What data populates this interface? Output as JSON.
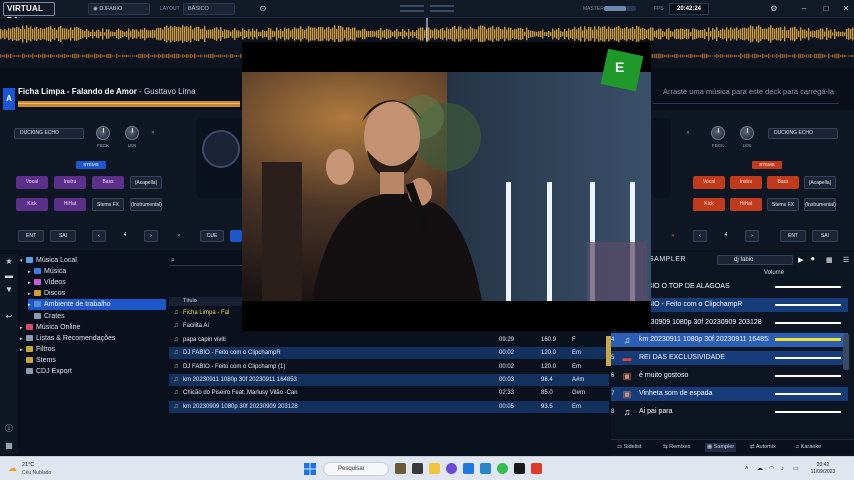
{
  "topbar": {
    "logo": "VIRTUAL DJ",
    "profile_label": "DJFABIO",
    "layout_label": "LAYOUT",
    "layout_value": "BÁSICO",
    "master_label": "MASTER",
    "fps_label": "FPS",
    "clock": "20:42:24"
  },
  "deck_a": {
    "letter": "A",
    "title": "Ficha Limpa - Falando de Amor",
    "artist": " - Gusttavo Lima",
    "fx_select": "DUCKING ECHO",
    "knob1_label": "FBCK",
    "knob2_label": "LEN",
    "stems_tag": "STEMS",
    "stems": [
      "Vocal",
      "Instru",
      "Bass",
      "Kick",
      "HiHat"
    ],
    "acapella": "(Acapella)",
    "instrumental": "(Instrumental)",
    "stems_fx": "Stems FX",
    "ent": "ENT",
    "sai": "SAI",
    "loop_prev": "‹",
    "loop_value": "4",
    "loop_next": "›",
    "cue": "CUE",
    "loop_label": "LOOP",
    "pitch_label": "PAD"
  },
  "deck_b": {
    "hint": "Arraste uma música para este deck para carregá-la",
    "fx_select": "DUCKING ECHO",
    "knob1_label": "FBCK",
    "knob2_label": "LEN",
    "stems_tag": "STEMS",
    "stems": [
      "Vocal",
      "Instru",
      "Bass",
      "Kick",
      "HiHat"
    ],
    "acapella": "(Acapella)",
    "instrumental": "(Instrumental)",
    "stems_fx": "Stems FX",
    "ent": "ENT",
    "sai": "SAI",
    "loop_prev": "‹",
    "loop_value": "4",
    "loop_next": "›",
    "loop_label": "LOOP",
    "pitch_label": "PAD"
  },
  "tree": [
    {
      "label": "Música Local",
      "indent": 0,
      "color": "#5aa0e6",
      "expand": "▾"
    },
    {
      "label": "Música",
      "indent": 1,
      "color": "#3b7de0",
      "expand": "▸"
    },
    {
      "label": "Vídeos",
      "indent": 1,
      "color": "#c85ad8",
      "expand": "▸"
    },
    {
      "label": "Discos",
      "indent": 1,
      "color": "#d99a36",
      "expand": "▸"
    },
    {
      "label": "Ambiente de trabalho",
      "indent": 1,
      "color": "#4f8fd8",
      "expand": "▸",
      "selected": true
    },
    {
      "label": "Crates",
      "indent": 1,
      "color": "#8b9bb2",
      "expand": ""
    },
    {
      "label": "Música Online",
      "indent": 0,
      "color": "#d84a6a",
      "expand": "▸"
    },
    {
      "label": "Listas & Recomendações",
      "indent": 0,
      "color": "#8b9bb2",
      "expand": "▸"
    },
    {
      "label": "Filtros",
      "indent": 0,
      "color": "#c8a640",
      "expand": "▸"
    },
    {
      "label": "Stems",
      "indent": 0,
      "color": "#c8a640",
      "expand": ""
    },
    {
      "label": "CDJ Export",
      "indent": 0,
      "color": "#8b9bb2",
      "expand": ""
    }
  ],
  "file_list": {
    "col_title": "Título",
    "rows": [
      {
        "title": "Ficha Limpa - Fal",
        "time": "",
        "bpm": "",
        "key": "",
        "highlight": false,
        "title_color": "#f1de3a"
      },
      {
        "title": "Facilita Aí",
        "time": "",
        "bpm": "",
        "key": "",
        "highlight": false,
        "title_color": "#e6ecf5"
      },
      {
        "title": "papa capin viviti",
        "time": "09:29",
        "bpm": "160.9",
        "key": "F",
        "highlight": false,
        "title_color": "#e6ecf5"
      },
      {
        "title": "DJ FABIO - Feito com o ClipchampR",
        "time": "00:02",
        "bpm": "120.0",
        "key": "Em",
        "highlight": true,
        "title_color": "#e6ecf5"
      },
      {
        "title": "DJ FABIO - Feito com o Clipchamp (1)",
        "time": "00:02",
        "bpm": "120.0",
        "key": "Em",
        "highlight": false,
        "title_color": "#e6ecf5"
      },
      {
        "title": "km 20230911 1080p 30f 20230911 164853",
        "time": "00:03",
        "bpm": "98.4",
        "key": "A#m",
        "highlight": true,
        "title_color": "#e6ecf5"
      },
      {
        "title": "Chicão do Piseiro Feat. Marlusy Vilão -Can",
        "time": "02:33",
        "bpm": "85.0",
        "key": "G#m",
        "highlight": false,
        "title_color": "#e6ecf5"
      },
      {
        "title": "km 20230909 1080p 30f 20230909 203128",
        "time": "00:05",
        "bpm": "93.5",
        "key": "Em",
        "highlight": true,
        "title_color": "#e6ecf5"
      }
    ]
  },
  "sampler": {
    "title": "SAMPLER",
    "preset": "dj fabio",
    "col_volume": "Volume",
    "rows": [
      {
        "num": "",
        "name": "FABIO O TOP DE ALAGOAS",
        "style": "dark",
        "vol": "w"
      },
      {
        "num": "",
        "name": "FABIO - Feito com o ClipchampR",
        "style": "blue",
        "vol": "w"
      },
      {
        "num": "",
        "name": "20230909 1080p 30f 20230909 203128",
        "style": "dark",
        "vol": "w"
      },
      {
        "num": "4",
        "name": "km 20230911 1080p 30f 20230911 164853",
        "style": "sel",
        "vol": "y"
      },
      {
        "num": "5",
        "name": "REI DAS EXCLUSIVIDADE",
        "style": "blue",
        "vol": "w"
      },
      {
        "num": "6",
        "name": "é muito gostoso",
        "style": "dark",
        "vol": "w"
      },
      {
        "num": "7",
        "name": "Vinheta som de espada",
        "style": "blue",
        "vol": "w"
      },
      {
        "num": "8",
        "name": "Ai pai para",
        "style": "dark",
        "vol": "w"
      }
    ],
    "tabs": [
      "Sidelist",
      "Remixes",
      "Sampler",
      "Automix",
      "Karaoke"
    ]
  },
  "taskbar": {
    "temp": "21°C",
    "weather": "Céu Nublado",
    "search": "Pesquisar",
    "time": "20:42",
    "date": "11/09/2023"
  },
  "colors": {
    "accent": "#1d56c8",
    "stem_purple": "#5c2f8a",
    "stem_red": "#c23a1c",
    "sampler_blue": "#163d7a"
  }
}
